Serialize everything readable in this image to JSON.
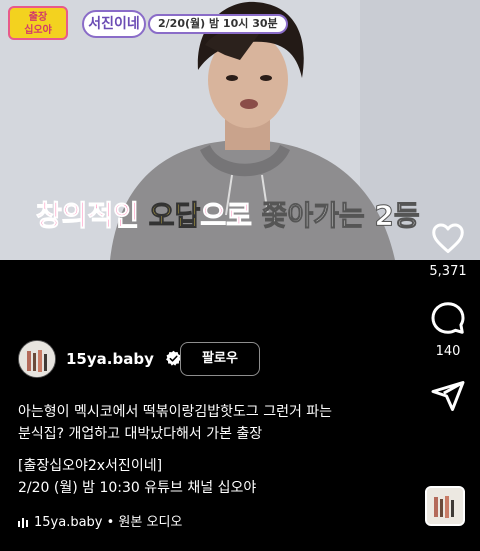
{
  "video": {
    "show_badge": "출장\n십오야",
    "show_title": "서진이네",
    "air_time": "2/20(월) 밤 10시 30분",
    "subtitle": {
      "part1": "창의적인 ",
      "part2": "오답",
      "part3": "으로 ",
      "part4": "쫓아가는 2등"
    }
  },
  "actions": {
    "like_count": "5,371",
    "comment_count": "140"
  },
  "author": {
    "username": "15ya.baby",
    "follow_label": "팔로우"
  },
  "caption": {
    "line1": "아는형이 멕시코에서 떡볶이랑김밥핫도그 그런거 파는",
    "line2": "분식집? 개업하고 대박났다해서 가본 출장",
    "line3": "[출장십오야2x서진이네]",
    "line4": "2/20 (월) 밤 10:30 유튜브 채널 십오야"
  },
  "audio": {
    "label": "15ya.baby • 원본 오디오"
  },
  "colors": {
    "background": "#000000",
    "subtitle_pink": "#ff3b8b",
    "subtitle_yellow": "#ffe04a"
  }
}
